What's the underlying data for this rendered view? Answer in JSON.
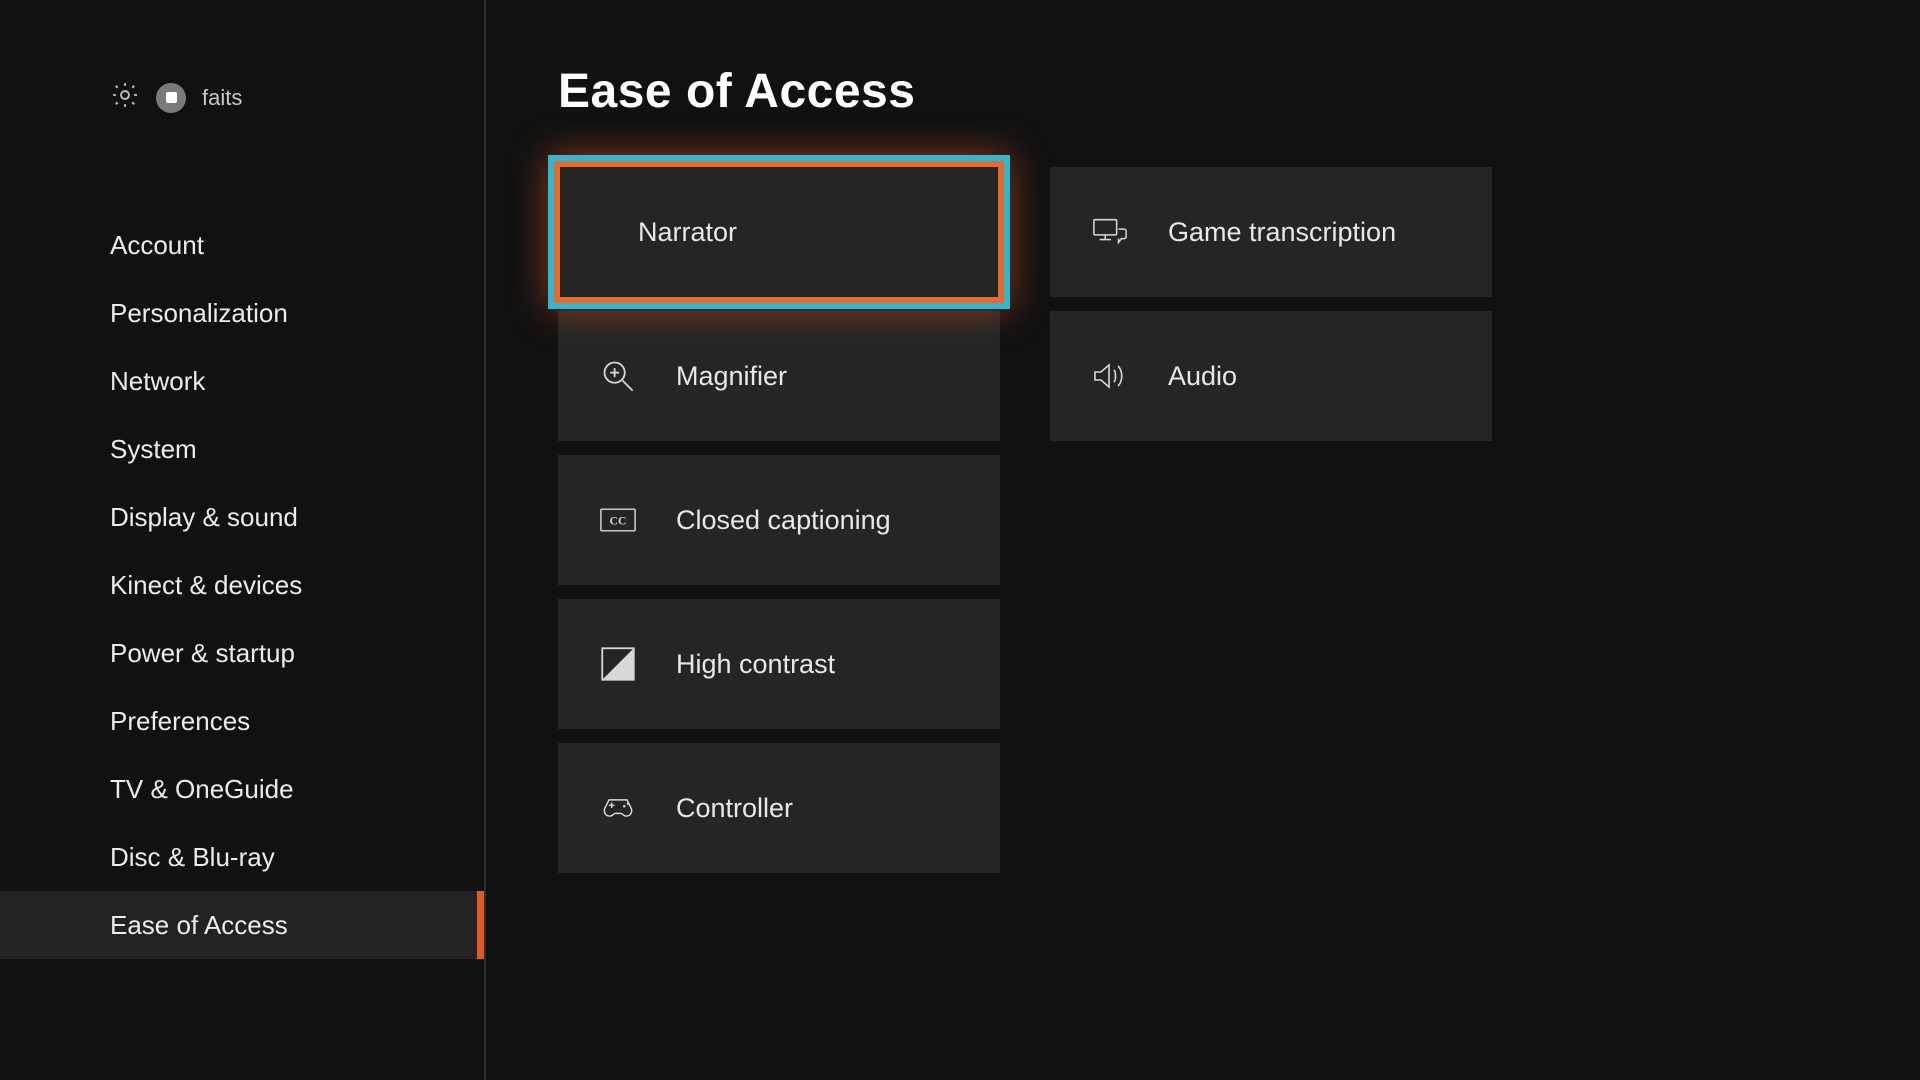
{
  "header": {
    "profile_name": "faits"
  },
  "page": {
    "title": "Ease of Access"
  },
  "sidebar": {
    "items": [
      {
        "label": "Account",
        "active": false
      },
      {
        "label": "Personalization",
        "active": false
      },
      {
        "label": "Network",
        "active": false
      },
      {
        "label": "System",
        "active": false
      },
      {
        "label": "Display & sound",
        "active": false
      },
      {
        "label": "Kinect & devices",
        "active": false
      },
      {
        "label": "Power & startup",
        "active": false
      },
      {
        "label": "Preferences",
        "active": false
      },
      {
        "label": "TV & OneGuide",
        "active": false
      },
      {
        "label": "Disc & Blu-ray",
        "active": false
      },
      {
        "label": "Ease of Access",
        "active": true
      }
    ]
  },
  "tiles": {
    "col1": [
      {
        "label": "Narrator",
        "icon": "narrator-icon",
        "focused": true
      },
      {
        "label": "Magnifier",
        "icon": "magnifier-icon",
        "focused": false
      },
      {
        "label": "Closed captioning",
        "icon": "closed-captioning-icon",
        "focused": false
      },
      {
        "label": "High contrast",
        "icon": "high-contrast-icon",
        "focused": false
      },
      {
        "label": "Controller",
        "icon": "controller-icon",
        "focused": false
      }
    ],
    "col2": [
      {
        "label": "Game transcription",
        "icon": "game-transcription-icon",
        "focused": false
      },
      {
        "label": "Audio",
        "icon": "audio-icon",
        "focused": false
      }
    ]
  }
}
